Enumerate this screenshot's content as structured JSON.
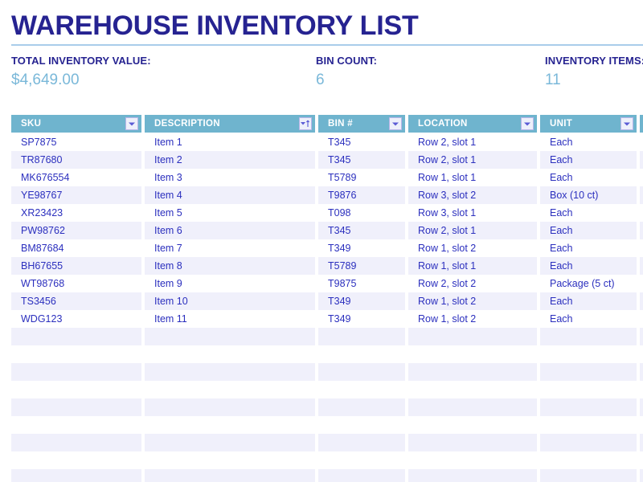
{
  "header": {
    "title": "WAREHOUSE INVENTORY LIST"
  },
  "metrics": [
    {
      "label": "TOTAL INVENTORY VALUE:",
      "value": "$4,649.00"
    },
    {
      "label": "BIN COUNT:",
      "value": "6"
    },
    {
      "label": "INVENTORY ITEMS:",
      "value": "11"
    }
  ],
  "table": {
    "columns": [
      {
        "label": "SKU",
        "icon": "filter-dropdown-icon",
        "sorted": false
      },
      {
        "label": "DESCRIPTION",
        "icon": "filter-sort-ascending-icon",
        "sorted": true
      },
      {
        "label": "BIN #",
        "icon": "filter-dropdown-icon",
        "sorted": false
      },
      {
        "label": "LOCATION",
        "icon": "filter-dropdown-icon",
        "sorted": false
      },
      {
        "label": "UNIT",
        "icon": "filter-dropdown-icon",
        "sorted": false
      },
      {
        "label": "",
        "icon": "filter-dropdown-icon",
        "sorted": false
      }
    ],
    "rows": [
      {
        "sku": "SP7875",
        "description": "Item 1",
        "bin": "T345",
        "location": "Row 2, slot 1",
        "unit": "Each"
      },
      {
        "sku": "TR87680",
        "description": "Item 2",
        "bin": "T345",
        "location": "Row 2, slot 1",
        "unit": "Each"
      },
      {
        "sku": "MK676554",
        "description": "Item 3",
        "bin": "T5789",
        "location": "Row 1, slot 1",
        "unit": "Each"
      },
      {
        "sku": "YE98767",
        "description": "Item 4",
        "bin": "T9876",
        "location": "Row 3, slot 2",
        "unit": "Box (10 ct)"
      },
      {
        "sku": "XR23423",
        "description": "Item 5",
        "bin": "T098",
        "location": "Row 3, slot 1",
        "unit": "Each"
      },
      {
        "sku": "PW98762",
        "description": "Item 6",
        "bin": "T345",
        "location": "Row 2, slot 1",
        "unit": "Each"
      },
      {
        "sku": "BM87684",
        "description": "Item 7",
        "bin": "T349",
        "location": "Row 1, slot 2",
        "unit": "Each"
      },
      {
        "sku": "BH67655",
        "description": "Item 8",
        "bin": "T5789",
        "location": "Row 1, slot 1",
        "unit": "Each"
      },
      {
        "sku": "WT98768",
        "description": "Item 9",
        "bin": "T9875",
        "location": "Row 2, slot 2",
        "unit": "Package (5 ct)"
      },
      {
        "sku": "TS3456",
        "description": "Item 10",
        "bin": "T349",
        "location": "Row 1, slot 2",
        "unit": "Each"
      },
      {
        "sku": "WDG123",
        "description": "Item 11",
        "bin": "T349",
        "location": "Row 1, slot 2",
        "unit": "Each"
      }
    ],
    "empty_row_count": 9
  },
  "colors": {
    "title": "#262391",
    "accent_rule": "#a9cdea",
    "metric_value": "#7ab8d9",
    "header_band": "#6fb4ce",
    "row_band": "#f0f0fb",
    "cell_text": "#2b2fbe"
  }
}
